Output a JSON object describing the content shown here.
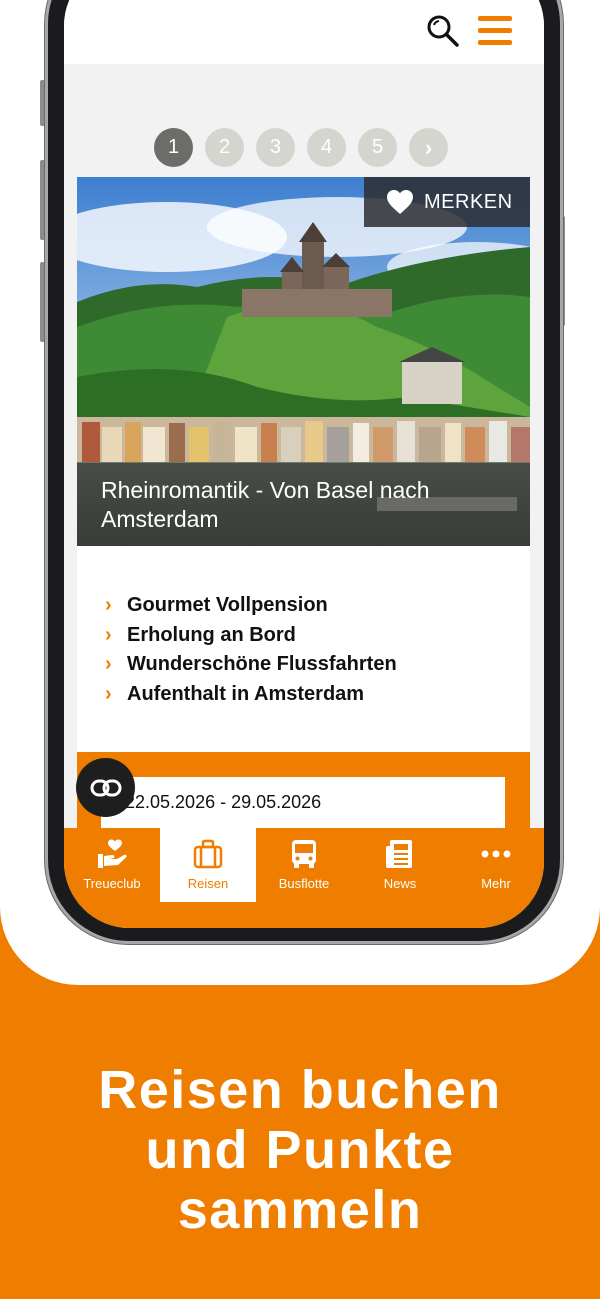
{
  "pagination": {
    "pages": [
      "1",
      "2",
      "3",
      "4",
      "5"
    ],
    "next_label": "›",
    "active_page": "1"
  },
  "card": {
    "save_label": "MERKEN",
    "title": "Rheinromantik - Von Basel nach Amsterdam",
    "features": [
      "Gourmet Vollpension",
      "Erholung an Bord",
      "Wunderschöne Flussfahrten",
      "Aufenthalt in Amsterdam"
    ],
    "date_range": "22.05.2026 - 29.05.2026"
  },
  "bottom_nav": {
    "items": [
      {
        "label": "Treueclub",
        "icon": "hand-heart-icon"
      },
      {
        "label": "Reisen",
        "icon": "suitcase-icon"
      },
      {
        "label": "Busflotte",
        "icon": "bus-icon"
      },
      {
        "label": "News",
        "icon": "newspaper-icon"
      },
      {
        "label": "Mehr",
        "icon": "more-dots-icon"
      }
    ],
    "active": "Reisen"
  },
  "headline": {
    "line1": "Reisen buchen",
    "line2": "und Punkte",
    "line3": "sammeln"
  },
  "colors": {
    "accent": "#ef7d00",
    "active_page_dot": "#6c6c68",
    "page_dot": "#d5d5cf"
  }
}
